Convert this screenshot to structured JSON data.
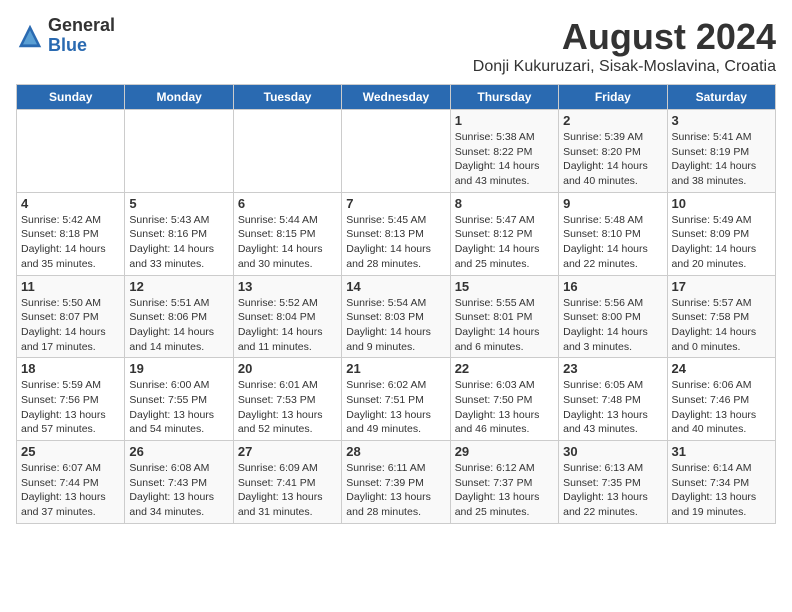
{
  "logo": {
    "general": "General",
    "blue": "Blue"
  },
  "header": {
    "month": "August 2024",
    "location": "Donji Kukuruzari, Sisak-Moslavina, Croatia"
  },
  "days_of_week": [
    "Sunday",
    "Monday",
    "Tuesday",
    "Wednesday",
    "Thursday",
    "Friday",
    "Saturday"
  ],
  "weeks": [
    [
      {
        "day": "",
        "info": ""
      },
      {
        "day": "",
        "info": ""
      },
      {
        "day": "",
        "info": ""
      },
      {
        "day": "",
        "info": ""
      },
      {
        "day": "1",
        "info": "Sunrise: 5:38 AM\nSunset: 8:22 PM\nDaylight: 14 hours\nand 43 minutes."
      },
      {
        "day": "2",
        "info": "Sunrise: 5:39 AM\nSunset: 8:20 PM\nDaylight: 14 hours\nand 40 minutes."
      },
      {
        "day": "3",
        "info": "Sunrise: 5:41 AM\nSunset: 8:19 PM\nDaylight: 14 hours\nand 38 minutes."
      }
    ],
    [
      {
        "day": "4",
        "info": "Sunrise: 5:42 AM\nSunset: 8:18 PM\nDaylight: 14 hours\nand 35 minutes."
      },
      {
        "day": "5",
        "info": "Sunrise: 5:43 AM\nSunset: 8:16 PM\nDaylight: 14 hours\nand 33 minutes."
      },
      {
        "day": "6",
        "info": "Sunrise: 5:44 AM\nSunset: 8:15 PM\nDaylight: 14 hours\nand 30 minutes."
      },
      {
        "day": "7",
        "info": "Sunrise: 5:45 AM\nSunset: 8:13 PM\nDaylight: 14 hours\nand 28 minutes."
      },
      {
        "day": "8",
        "info": "Sunrise: 5:47 AM\nSunset: 8:12 PM\nDaylight: 14 hours\nand 25 minutes."
      },
      {
        "day": "9",
        "info": "Sunrise: 5:48 AM\nSunset: 8:10 PM\nDaylight: 14 hours\nand 22 minutes."
      },
      {
        "day": "10",
        "info": "Sunrise: 5:49 AM\nSunset: 8:09 PM\nDaylight: 14 hours\nand 20 minutes."
      }
    ],
    [
      {
        "day": "11",
        "info": "Sunrise: 5:50 AM\nSunset: 8:07 PM\nDaylight: 14 hours\nand 17 minutes."
      },
      {
        "day": "12",
        "info": "Sunrise: 5:51 AM\nSunset: 8:06 PM\nDaylight: 14 hours\nand 14 minutes."
      },
      {
        "day": "13",
        "info": "Sunrise: 5:52 AM\nSunset: 8:04 PM\nDaylight: 14 hours\nand 11 minutes."
      },
      {
        "day": "14",
        "info": "Sunrise: 5:54 AM\nSunset: 8:03 PM\nDaylight: 14 hours\nand 9 minutes."
      },
      {
        "day": "15",
        "info": "Sunrise: 5:55 AM\nSunset: 8:01 PM\nDaylight: 14 hours\nand 6 minutes."
      },
      {
        "day": "16",
        "info": "Sunrise: 5:56 AM\nSunset: 8:00 PM\nDaylight: 14 hours\nand 3 minutes."
      },
      {
        "day": "17",
        "info": "Sunrise: 5:57 AM\nSunset: 7:58 PM\nDaylight: 14 hours\nand 0 minutes."
      }
    ],
    [
      {
        "day": "18",
        "info": "Sunrise: 5:59 AM\nSunset: 7:56 PM\nDaylight: 13 hours\nand 57 minutes."
      },
      {
        "day": "19",
        "info": "Sunrise: 6:00 AM\nSunset: 7:55 PM\nDaylight: 13 hours\nand 54 minutes."
      },
      {
        "day": "20",
        "info": "Sunrise: 6:01 AM\nSunset: 7:53 PM\nDaylight: 13 hours\nand 52 minutes."
      },
      {
        "day": "21",
        "info": "Sunrise: 6:02 AM\nSunset: 7:51 PM\nDaylight: 13 hours\nand 49 minutes."
      },
      {
        "day": "22",
        "info": "Sunrise: 6:03 AM\nSunset: 7:50 PM\nDaylight: 13 hours\nand 46 minutes."
      },
      {
        "day": "23",
        "info": "Sunrise: 6:05 AM\nSunset: 7:48 PM\nDaylight: 13 hours\nand 43 minutes."
      },
      {
        "day": "24",
        "info": "Sunrise: 6:06 AM\nSunset: 7:46 PM\nDaylight: 13 hours\nand 40 minutes."
      }
    ],
    [
      {
        "day": "25",
        "info": "Sunrise: 6:07 AM\nSunset: 7:44 PM\nDaylight: 13 hours\nand 37 minutes."
      },
      {
        "day": "26",
        "info": "Sunrise: 6:08 AM\nSunset: 7:43 PM\nDaylight: 13 hours\nand 34 minutes."
      },
      {
        "day": "27",
        "info": "Sunrise: 6:09 AM\nSunset: 7:41 PM\nDaylight: 13 hours\nand 31 minutes."
      },
      {
        "day": "28",
        "info": "Sunrise: 6:11 AM\nSunset: 7:39 PM\nDaylight: 13 hours\nand 28 minutes."
      },
      {
        "day": "29",
        "info": "Sunrise: 6:12 AM\nSunset: 7:37 PM\nDaylight: 13 hours\nand 25 minutes."
      },
      {
        "day": "30",
        "info": "Sunrise: 6:13 AM\nSunset: 7:35 PM\nDaylight: 13 hours\nand 22 minutes."
      },
      {
        "day": "31",
        "info": "Sunrise: 6:14 AM\nSunset: 7:34 PM\nDaylight: 13 hours\nand 19 minutes."
      }
    ]
  ]
}
